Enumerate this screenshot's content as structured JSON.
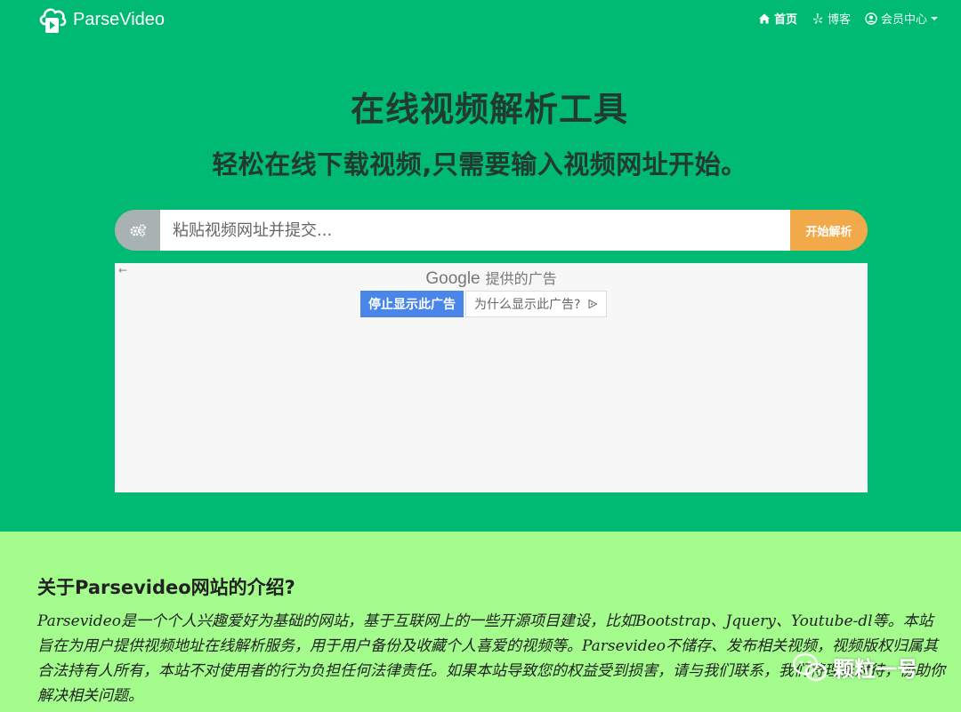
{
  "navbar": {
    "brand": "ParseVideo",
    "links": [
      {
        "label": "首页",
        "icon": "home-icon"
      },
      {
        "label": "博客",
        "icon": "yelp-icon"
      },
      {
        "label": "会员中心",
        "icon": "user-circle-icon"
      }
    ]
  },
  "hero": {
    "title": "在线视频解析工具",
    "subtitle": "轻松在线下载视频,只需要输入视频网址开始。"
  },
  "search": {
    "addon_icon": "gears-icon",
    "placeholder": "粘贴视频网址并提交...",
    "button": "开始解析"
  },
  "ad": {
    "back_arrow": "←",
    "provider_brand": "Google",
    "provider_text": "提供的广告",
    "stop_button": "停止显示此广告",
    "why_button": "为什么显示此广告?"
  },
  "about": {
    "title": "关于Parsevideo网站的介绍?",
    "body": "Parsevideo是一个个人兴趣爱好为基础的网站，基于互联网上的一些开源项目建设，比如Bootstrap、Jquery、Youtube-dl等。本站旨在为用户提供视频地址在线解析服务，用于用户备份及收藏个人喜爱的视频等。Parsevideo不储存、发布相关视频，视频版权归属其合法持有人所有，本站不对使用者的行为负担任何法律责任。如果本站导致您的权益受到损害，请与我们联系，我们将理性对待，协助你解决相关问题。"
  },
  "watermark": {
    "text": "颗粒一号",
    "icon": "wechat-icon"
  },
  "colors": {
    "hero_bg": "#00ba73",
    "about_bg": "#a3fc8c",
    "button_orange": "#f2a94a",
    "ad_blue": "#4a86e8"
  }
}
